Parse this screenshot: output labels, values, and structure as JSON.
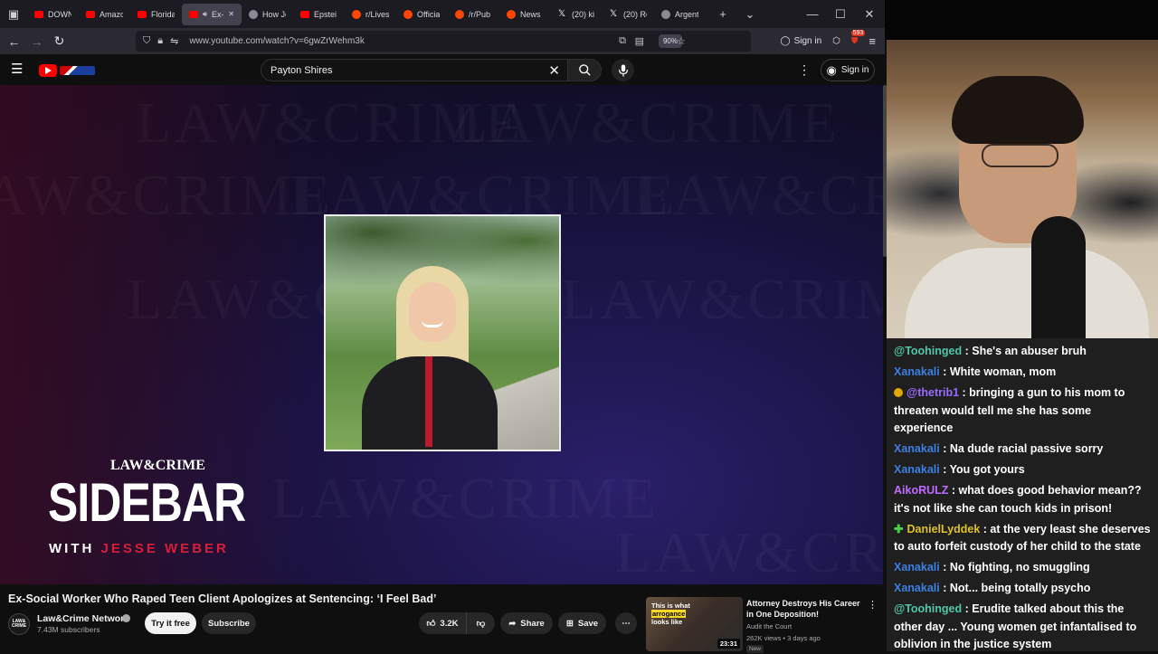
{
  "browser": {
    "tabs": [
      {
        "label": "DOWN",
        "fav": "yt",
        "active": false
      },
      {
        "label": "Amazo",
        "fav": "yt",
        "active": false
      },
      {
        "label": "Florida",
        "fav": "yt",
        "active": false
      },
      {
        "label": "Ex-",
        "fav": "yt",
        "active": true
      },
      {
        "label": "How Je",
        "fav": "gen",
        "active": false
      },
      {
        "label": "Epstei",
        "fav": "yt",
        "active": false
      },
      {
        "label": "r/Lives",
        "fav": "reddit",
        "active": false
      },
      {
        "label": "Officia",
        "fav": "reddit",
        "active": false
      },
      {
        "label": "/r/Pub",
        "fav": "reddit",
        "active": false
      },
      {
        "label": "News",
        "fav": "reddit",
        "active": false
      },
      {
        "label": "(20) ki",
        "fav": "x",
        "active": false
      },
      {
        "label": "(20) Re",
        "fav": "x",
        "active": false
      },
      {
        "label": "Argent",
        "fav": "gen",
        "active": false
      }
    ],
    "url": "www.youtube.com/watch?v=6gwZrWehm3k",
    "zoom": "90%",
    "sign_in": "Sign in",
    "extension_count": "593"
  },
  "youtube": {
    "search_value": "Payton Shires",
    "sign_in": "Sign in"
  },
  "video": {
    "brand": "LAW&CRIME",
    "show_title": "SIDEBAR",
    "show_sub_white": "WITH",
    "show_sub_red": "JESSE WEBER",
    "watermark": "LAW&CRIME",
    "title": "Ex-Social Worker Who Raped Teen Client Apologizes at Sentencing: ‘I Feel Bad’",
    "channel": "Law&Crime Network",
    "channel_avatar_text": "LAW& CRIME",
    "subscribers": "7.43M subscribers",
    "try_free": "Try it free",
    "subscribe": "Subscribe",
    "likes": "3.2K",
    "share": "Share",
    "save": "Save"
  },
  "recommendation": {
    "thumb_text_1": "This is what",
    "thumb_text_hl": "arrogance",
    "thumb_text_2": "looks like",
    "duration": "23:31",
    "title": "Attorney Destroys His Career in One Deposition!",
    "channel": "Audit the Court",
    "meta": "262K views • 3 days ago",
    "badge": "New"
  },
  "chat": [
    {
      "user": "@Toohinged",
      "color": "#4fc7a8",
      "text": "She's an abuser bruh",
      "badge": ""
    },
    {
      "user": "Xanakali",
      "color": "#3d7fe0",
      "text": "White woman, mom",
      "badge": ""
    },
    {
      "user": "@thetrib1",
      "color": "#9a6bff",
      "text": "bringing a gun to his mom to threaten would tell me she has some experience",
      "badge": "gold"
    },
    {
      "user": "Xanakali",
      "color": "#3d7fe0",
      "text": "Na dude racial passive sorry",
      "badge": ""
    },
    {
      "user": "Xanakali",
      "color": "#3d7fe0",
      "text": "You got yours",
      "badge": ""
    },
    {
      "user": "AikoRULZ",
      "color": "#c06bff",
      "text": "what does good behavior mean?? it's not like she can touch kids in prison!",
      "badge": ""
    },
    {
      "user": "DanielLyddek",
      "color": "#e0c21f",
      "text": "at the very least she deserves to auto forfeit custody of her child to the state",
      "badge": "green"
    },
    {
      "user": "Xanakali",
      "color": "#3d7fe0",
      "text": "No fighting, no smuggling",
      "badge": ""
    },
    {
      "user": "Xanakali",
      "color": "#3d7fe0",
      "text": "Not... being totally psycho",
      "badge": ""
    },
    {
      "user": "@Toohinged",
      "color": "#4fc7a8",
      "text": "Erudite talked about this the other day ... Young women get infantalised to oblivion in the justice system",
      "badge": ""
    }
  ]
}
